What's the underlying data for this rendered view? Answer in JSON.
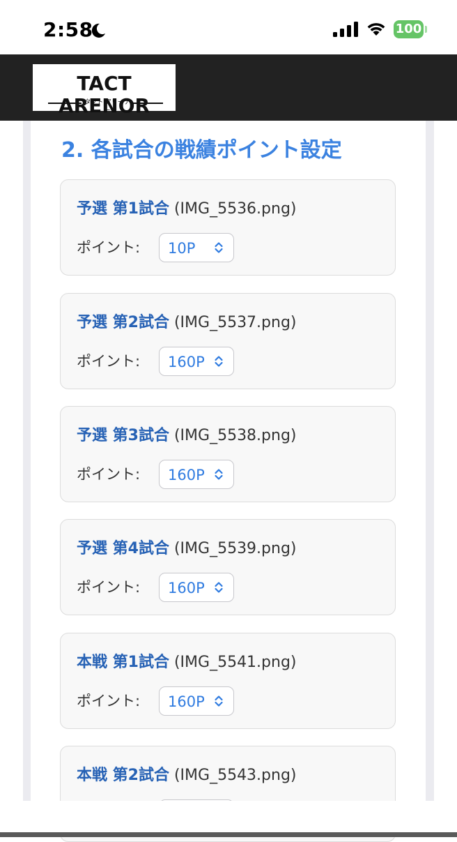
{
  "status_bar": {
    "time": "2:58",
    "battery": "100",
    "moon_icon": "moon-icon",
    "signal_icon": "cellular-signal-icon",
    "wifi_icon": "wifi-icon"
  },
  "header": {
    "logo_text": "TACT ARENOR",
    "logo_subtext": "タクト アリーナー",
    "background_color": "#222222"
  },
  "section": {
    "title": "2. 各試合の戦績ポイント設定",
    "title_color": "#3b82e0"
  },
  "matches": [
    {
      "label": "予選 第1試合",
      "file": "(IMG_5536.png)",
      "point_label": "ポイント:",
      "point_value": "10P"
    },
    {
      "label": "予選 第2試合",
      "file": "(IMG_5537.png)",
      "point_label": "ポイント:",
      "point_value": "160P"
    },
    {
      "label": "予選 第3試合",
      "file": "(IMG_5538.png)",
      "point_label": "ポイント:",
      "point_value": "160P"
    },
    {
      "label": "予選 第4試合",
      "file": "(IMG_5539.png)",
      "point_label": "ポイント:",
      "point_value": "160P"
    },
    {
      "label": "本戦 第1試合",
      "file": "(IMG_5541.png)",
      "point_label": "ポイント:",
      "point_value": "160P"
    },
    {
      "label": "本戦 第2試合",
      "file": "(IMG_5543.png)"
    }
  ],
  "colors": {
    "accent": "#3b82e0",
    "match_label": "#2762b5",
    "card_background": "#f8f8f8",
    "battery": "#65c466"
  }
}
